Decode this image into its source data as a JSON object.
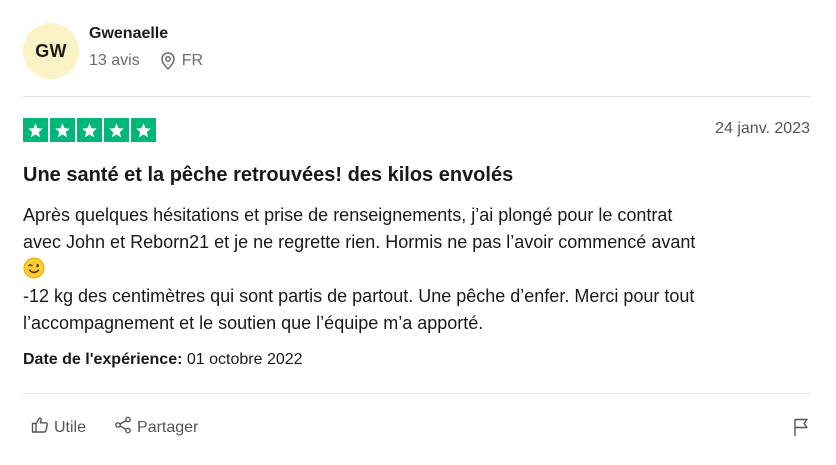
{
  "reviewer": {
    "initials": "GW",
    "name": "Gwenaelle",
    "review_count": "13 avis",
    "country": "FR",
    "icons": {
      "location": "map-pin-icon"
    }
  },
  "review": {
    "rating": 5,
    "max_rating": 5,
    "star_color": "#00b67a",
    "date": "24 janv. 2023",
    "title": "Une santé et la pêche retrouvées! des kilos envolés",
    "body_lines": [
      "Après quelques hésitations et prise de renseignements, j’ai plongé pour le contrat",
      "avec John et Reborn21 et je ne regrette rien. Hormis ne pas l’avoir commencé avant",
      "-12 kg des centimètres qui sont partis de partout. Une pêche d’enfer. Merci pour tout",
      "l’accompagnement et le soutien que l’équipe m’a apporté."
    ],
    "experience_label": "Date de l'expérience:",
    "experience_date": "01 octobre 2022"
  },
  "actions": {
    "useful_label": "Utile",
    "share_label": "Partager",
    "icons": {
      "useful": "thumbs-up-icon",
      "share": "share-icon",
      "report": "flag-icon"
    }
  },
  "colors": {
    "avatar_bg": "#fbf2c5",
    "muted_text": "#6b6b6b"
  }
}
